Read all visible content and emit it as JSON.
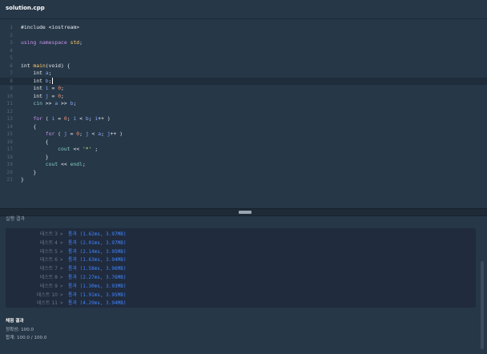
{
  "header": {
    "file_name": "solution.cpp"
  },
  "editor": {
    "lines": [
      {
        "num": "1",
        "tokens": [
          {
            "t": "#include <iostream>",
            "c": "t-dir"
          }
        ]
      },
      {
        "num": "2",
        "tokens": []
      },
      {
        "num": "3",
        "tokens": [
          {
            "t": "using",
            "c": "t-key"
          },
          {
            "t": " ",
            "c": "t-plain"
          },
          {
            "t": "namespace",
            "c": "t-key"
          },
          {
            "t": " ",
            "c": "t-plain"
          },
          {
            "t": "std",
            "c": "t-fn"
          },
          {
            "t": ";",
            "c": "t-plain"
          }
        ]
      },
      {
        "num": "4",
        "tokens": []
      },
      {
        "num": "5",
        "tokens": []
      },
      {
        "num": "6",
        "tokens": [
          {
            "t": "int",
            "c": "t-kw"
          },
          {
            "t": " ",
            "c": "t-plain"
          },
          {
            "t": "main",
            "c": "t-fn"
          },
          {
            "t": "(void) {",
            "c": "t-plain"
          }
        ]
      },
      {
        "num": "7",
        "tokens": [
          {
            "t": "    int ",
            "c": "t-plain"
          },
          {
            "t": "a",
            "c": "t-var"
          },
          {
            "t": ";",
            "c": "t-plain"
          }
        ]
      },
      {
        "num": "8",
        "tokens": [
          {
            "t": "    int ",
            "c": "t-plain"
          },
          {
            "t": "b",
            "c": "t-var"
          },
          {
            "t": ";",
            "c": "t-plain"
          }
        ],
        "active": true,
        "cursor": true
      },
      {
        "num": "9",
        "tokens": [
          {
            "t": "    int ",
            "c": "t-plain"
          },
          {
            "t": "i",
            "c": "t-var"
          },
          {
            "t": " = ",
            "c": "t-plain"
          },
          {
            "t": "0",
            "c": "t-num"
          },
          {
            "t": ";",
            "c": "t-plain"
          }
        ]
      },
      {
        "num": "10",
        "tokens": [
          {
            "t": "    int ",
            "c": "t-plain"
          },
          {
            "t": "j",
            "c": "t-var"
          },
          {
            "t": " = ",
            "c": "t-plain"
          },
          {
            "t": "0",
            "c": "t-num"
          },
          {
            "t": ";",
            "c": "t-plain"
          }
        ]
      },
      {
        "num": "11",
        "tokens": [
          {
            "t": "    ",
            "c": "t-plain"
          },
          {
            "t": "cin",
            "c": "t-id"
          },
          {
            "t": " >> ",
            "c": "t-plain"
          },
          {
            "t": "a",
            "c": "t-var"
          },
          {
            "t": " >> ",
            "c": "t-plain"
          },
          {
            "t": "b",
            "c": "t-var"
          },
          {
            "t": ";",
            "c": "t-plain"
          }
        ]
      },
      {
        "num": "12",
        "tokens": []
      },
      {
        "num": "13",
        "tokens": [
          {
            "t": "    ",
            "c": "t-plain"
          },
          {
            "t": "for",
            "c": "t-key"
          },
          {
            "t": " ( ",
            "c": "t-plain"
          },
          {
            "t": "i",
            "c": "t-var"
          },
          {
            "t": " = ",
            "c": "t-plain"
          },
          {
            "t": "0",
            "c": "t-num"
          },
          {
            "t": "; ",
            "c": "t-plain"
          },
          {
            "t": "i",
            "c": "t-var"
          },
          {
            "t": " < ",
            "c": "t-plain"
          },
          {
            "t": "b",
            "c": "t-var"
          },
          {
            "t": "; ",
            "c": "t-plain"
          },
          {
            "t": "i",
            "c": "t-var"
          },
          {
            "t": "++ )",
            "c": "t-plain"
          }
        ]
      },
      {
        "num": "14",
        "tokens": [
          {
            "t": "    {",
            "c": "t-plain"
          }
        ]
      },
      {
        "num": "15",
        "tokens": [
          {
            "t": "        ",
            "c": "t-plain"
          },
          {
            "t": "for",
            "c": "t-key"
          },
          {
            "t": " ( ",
            "c": "t-plain"
          },
          {
            "t": "j",
            "c": "t-var"
          },
          {
            "t": " = ",
            "c": "t-plain"
          },
          {
            "t": "0",
            "c": "t-num"
          },
          {
            "t": "; ",
            "c": "t-plain"
          },
          {
            "t": "j",
            "c": "t-var"
          },
          {
            "t": " < ",
            "c": "t-plain"
          },
          {
            "t": "a",
            "c": "t-var"
          },
          {
            "t": "; ",
            "c": "t-plain"
          },
          {
            "t": "j",
            "c": "t-var"
          },
          {
            "t": "++ )",
            "c": "t-plain"
          }
        ]
      },
      {
        "num": "16",
        "tokens": [
          {
            "t": "        {",
            "c": "t-plain"
          }
        ]
      },
      {
        "num": "17",
        "tokens": [
          {
            "t": "            ",
            "c": "t-plain"
          },
          {
            "t": "cout",
            "c": "t-id"
          },
          {
            "t": " << ",
            "c": "t-plain"
          },
          {
            "t": "'*'",
            "c": "t-str"
          },
          {
            "t": " ;",
            "c": "t-plain"
          }
        ]
      },
      {
        "num": "18",
        "tokens": [
          {
            "t": "        }",
            "c": "t-plain"
          }
        ]
      },
      {
        "num": "19",
        "tokens": [
          {
            "t": "        ",
            "c": "t-plain"
          },
          {
            "t": "cout",
            "c": "t-id"
          },
          {
            "t": " << ",
            "c": "t-plain"
          },
          {
            "t": "endl",
            "c": "t-id"
          },
          {
            "t": ";",
            "c": "t-plain"
          }
        ]
      },
      {
        "num": "20",
        "tokens": [
          {
            "t": "    }",
            "c": "t-plain"
          }
        ]
      },
      {
        "num": "21",
        "tokens": [
          {
            "t": "}",
            "c": "t-plain"
          }
        ]
      }
    ]
  },
  "results": {
    "title": "실행 결과",
    "rows": [
      {
        "label": "테스트 3",
        "sep": ">",
        "value": "통과 (1.62ms, 3.97MB)"
      },
      {
        "label": "테스트 4",
        "sep": ">",
        "value": "통과 (2.01ms, 3.97MB)"
      },
      {
        "label": "테스트 5",
        "sep": ">",
        "value": "통과 (2.14ms, 3.95MB)"
      },
      {
        "label": "테스트 6",
        "sep": ">",
        "value": "통과 (1.63ms, 3.94MB)"
      },
      {
        "label": "테스트 7",
        "sep": ">",
        "value": "통과 (1.58ms, 3.96MB)"
      },
      {
        "label": "테스트 8",
        "sep": ">",
        "value": "통과 (2.27ms, 3.76MB)"
      },
      {
        "label": "테스트 9",
        "sep": ">",
        "value": "통과 (1.30ms, 3.93MB)"
      },
      {
        "label": "테스트 10",
        "sep": ">",
        "value": "통과 (1.91ms, 3.95MB)"
      },
      {
        "label": "테스트 11",
        "sep": ">",
        "value": "통과 (4.29ms, 3.94MB)"
      }
    ]
  },
  "summary": {
    "title": "채점 결과",
    "accuracy": "정확성: 100.0",
    "total": "합계: 100.0 / 100.0"
  },
  "colors": {
    "background": "#263747",
    "results_background": "#202b3d",
    "pass_value": "#3f85ff"
  }
}
